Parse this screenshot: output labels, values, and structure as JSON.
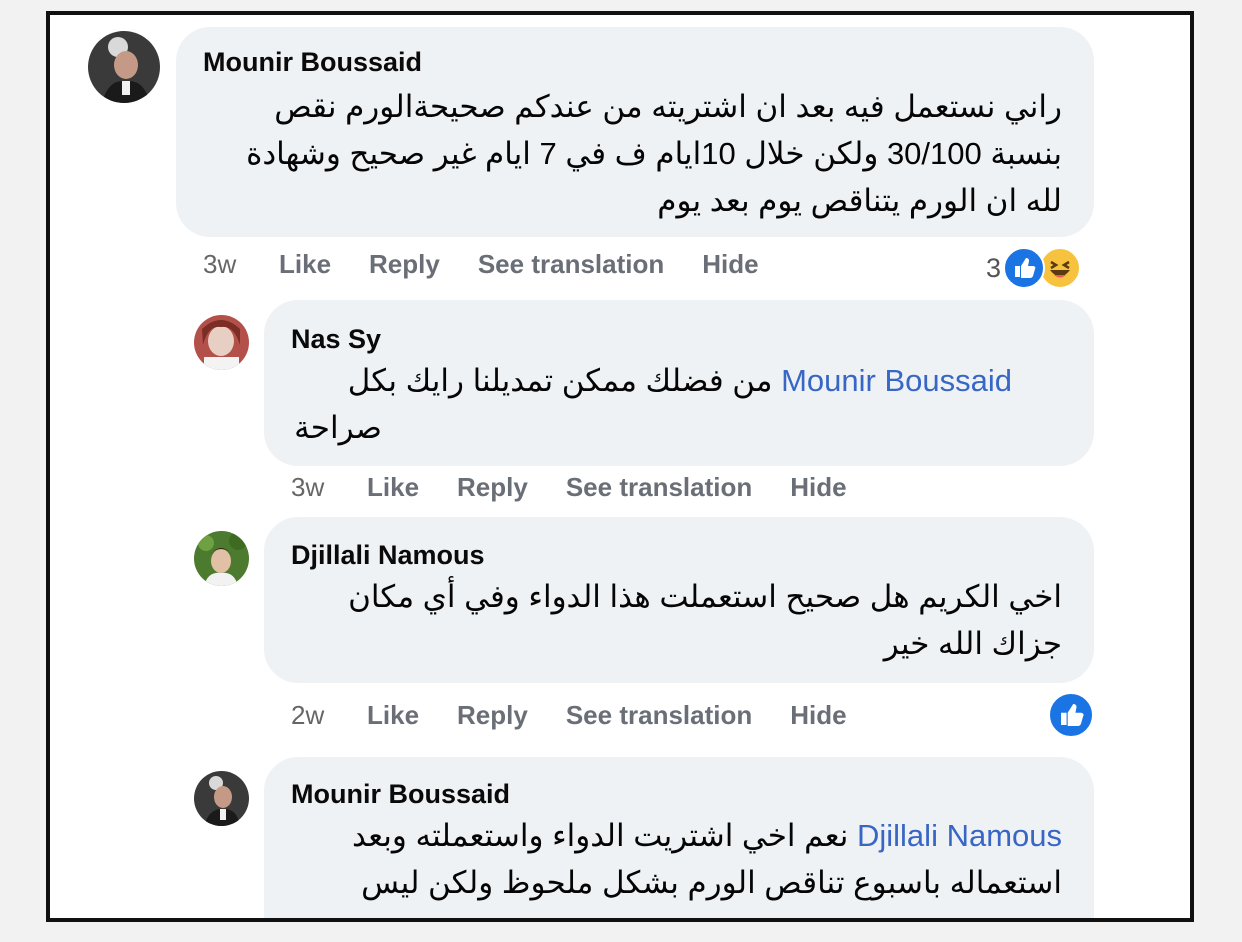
{
  "comments": [
    {
      "author": "Mounir Boussaid",
      "lines": [
        "راني نستعمل فيه بعد ان اشتريته من عندكم صحيحةالورم نقص",
        "بنسبة 30/100 ولكن خلال 10ايام ف في 7 ايام غير صحيح وشهادة",
        "لله ان الورم يتناقص يوم بعد يوم"
      ],
      "time": "3w",
      "actions": [
        "Like",
        "Reply",
        "See translation",
        "Hide"
      ],
      "reaction_count": "3",
      "reactions": [
        "like-icon",
        "haha-icon"
      ]
    },
    {
      "author": "Nas Sy",
      "mention": "Mounir Boussaid",
      "lines": [
        "من فضلك ممكن تمديلنا رايك بكل",
        "صراحة"
      ],
      "time": "3w",
      "actions": [
        "Like",
        "Reply",
        "See translation",
        "Hide"
      ]
    },
    {
      "author": "Djillali Namous",
      "lines": [
        "اخي الكريم هل صحيح استعملت هذا الدواء وفي أي مكان",
        "جزاك الله خير"
      ],
      "time": "2w",
      "actions": [
        "Like",
        "Reply",
        "See translation",
        "Hide"
      ],
      "reactions": [
        "like-icon"
      ]
    },
    {
      "author": "Mounir Boussaid",
      "mention": "Djillali Namous",
      "lines": [
        "نعم اخي اشتريت الدواء واستعملته وبعد",
        "استعماله باسبوع تناقص الورم بشكل ملحوظ ولكن ليس"
      ]
    }
  ],
  "colors": {
    "bubble": "#eff2f5",
    "mention": "#3866c5",
    "like_blue": "#1b74e4",
    "haha_yellow": "#f7c33f"
  }
}
